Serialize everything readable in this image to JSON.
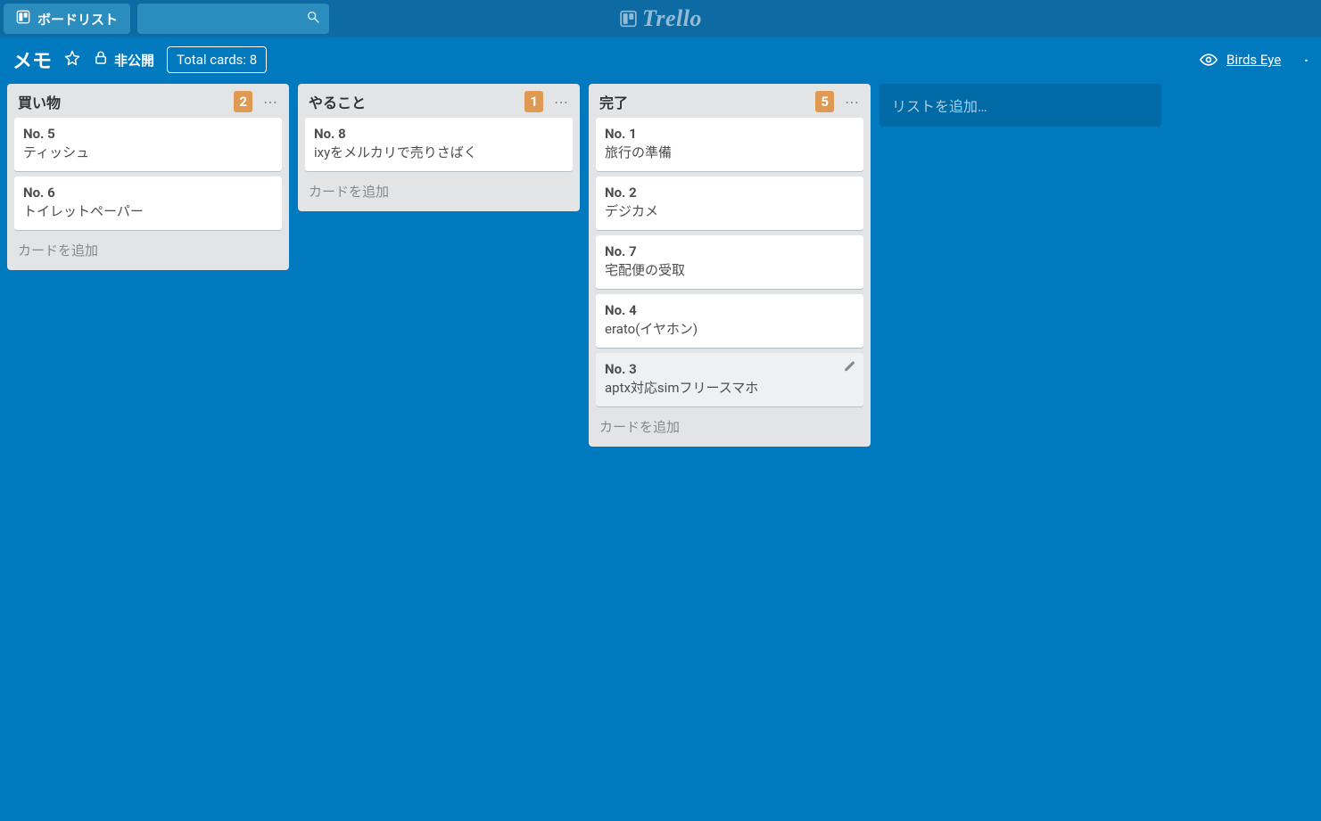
{
  "topbar": {
    "boards_button_label": "ボードリスト",
    "logo_text": "Trello"
  },
  "board_header": {
    "title": "メモ",
    "privacy_label": "非公開",
    "total_cards_label": "Total cards: 8",
    "birds_eye_label": "Birds Eye"
  },
  "lists": [
    {
      "title": "買い物",
      "count": "2",
      "add_card_label": "カードを追加",
      "cards": [
        {
          "no": "No. 5",
          "title": "ティッシュ",
          "hover": false
        },
        {
          "no": "No. 6",
          "title": "トイレットペーパー",
          "hover": false
        }
      ]
    },
    {
      "title": "やること",
      "count": "1",
      "add_card_label": "カードを追加",
      "cards": [
        {
          "no": "No. 8",
          "title": "ixyをメルカリで売りさばく",
          "hover": false
        }
      ]
    },
    {
      "title": "完了",
      "count": "5",
      "add_card_label": "カードを追加",
      "cards": [
        {
          "no": "No. 1",
          "title": "旅行の準備",
          "hover": false
        },
        {
          "no": "No. 2",
          "title": "デジカメ",
          "hover": false
        },
        {
          "no": "No. 7",
          "title": "宅配便の受取",
          "hover": false
        },
        {
          "no": "No. 4",
          "title": "erato(イヤホン)",
          "hover": false
        },
        {
          "no": "No. 3",
          "title": "aptx対応simフリースマホ",
          "hover": true
        }
      ]
    }
  ],
  "add_list_label": "リストを追加…"
}
